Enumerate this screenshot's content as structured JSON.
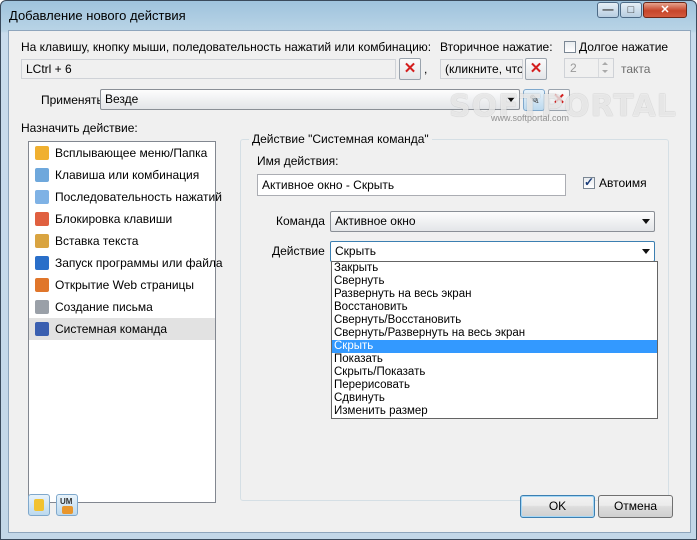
{
  "window": {
    "title": "Добавление нового действия",
    "controls": {
      "minimize": "—",
      "maximize": "□",
      "close": "✕"
    }
  },
  "trigger": {
    "label": "На клавишу, кнопку мыши, поледовательность нажатий или комбинацию:",
    "value": "LCtrl + 6",
    "separator": ",",
    "secondary_label": "Вторичное нажатие:",
    "secondary_value": "(кликните, что",
    "long_press_label": "Долгое нажатие",
    "long_press_checked": false,
    "ticks_value": "2",
    "ticks_label": "такта"
  },
  "apply": {
    "label": "Применять",
    "value": "Везде"
  },
  "watermark": {
    "text": "SOFTPORTAL",
    "url": "www.softportal.com"
  },
  "assign_label": "Назначить действие:",
  "actions": [
    {
      "label": "Всплывающее меню/Папка",
      "icon": "folder-menu-icon",
      "color": "#f0b030"
    },
    {
      "label": "Клавиша или комбинация",
      "icon": "keyboard-icon",
      "color": "#6fa8dc"
    },
    {
      "label": "Последовательность нажатий",
      "icon": "keys-sequence-icon",
      "color": "#7fb2e5"
    },
    {
      "label": "Блокировка клавиши",
      "icon": "key-lock-icon",
      "color": "#e06040"
    },
    {
      "label": "Вставка текста",
      "icon": "paste-text-icon",
      "color": "#d9a441"
    },
    {
      "label": "Запуск программы или файла",
      "icon": "run-program-icon",
      "color": "#2a6fc9"
    },
    {
      "label": "Открытие Web страницы",
      "icon": "web-page-icon",
      "color": "#e0762b"
    },
    {
      "label": "Создание письма",
      "icon": "email-icon",
      "color": "#9aa0a8"
    },
    {
      "label": "Системная команда",
      "icon": "system-command-icon",
      "color": "#3a5fb0"
    }
  ],
  "selected_action_index": 8,
  "group": {
    "legend": "Действие \"Системная команда\"",
    "name_label": "Имя действия:",
    "name_value": "Активное окно - Скрыть",
    "autoname_label": "Автоимя",
    "autoname_checked": true,
    "command_label": "Команда",
    "command_value": "Активное окно",
    "action_label": "Действие",
    "action_value": "Скрыть"
  },
  "dropdown_options": [
    "Закрыть",
    "Свернуть",
    "Развернуть на весь экран",
    "Восстановить",
    "Свернуть/Восстановить",
    "Свернуть/Развернуть на весь экран",
    "Скрыть",
    "Показать",
    "Скрыть/Показать",
    "Перерисовать",
    "Сдвинуть",
    "Изменить размер"
  ],
  "dropdown_highlight_index": 6,
  "buttons": {
    "ok": "OK",
    "cancel": "Отмена"
  },
  "footer_icons": [
    "pause-icon",
    "um-icon"
  ],
  "colors": {
    "accent": "#3399ff",
    "close_red": "#c7452a"
  }
}
